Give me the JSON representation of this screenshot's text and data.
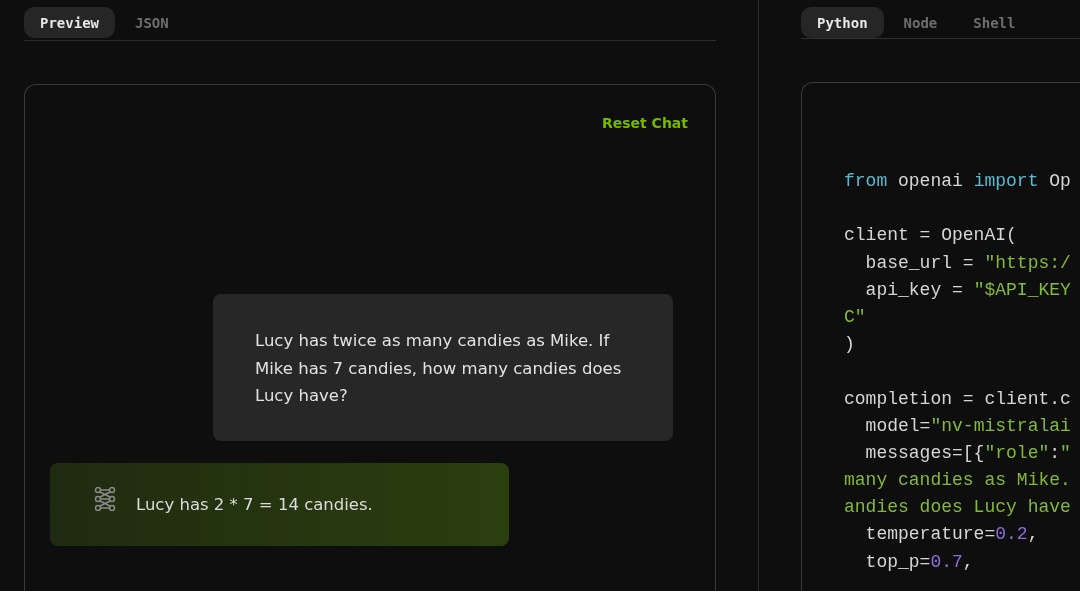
{
  "preview": {
    "tabs": [
      {
        "label": "Preview",
        "selected": true
      },
      {
        "label": "JSON",
        "selected": false
      }
    ],
    "reset_label": "Reset Chat",
    "messages": [
      {
        "kind": "user",
        "text": "Lucy has twice as many candies as Mike. If Mike has 7 candies, how many candies does Lucy have?"
      },
      {
        "kind": "assistant",
        "text": "Lucy has 2 * 7 = 14 candies."
      }
    ]
  },
  "code": {
    "tabs": [
      {
        "label": "Python",
        "selected": true
      },
      {
        "label": "Node",
        "selected": false
      },
      {
        "label": "Shell",
        "selected": false
      }
    ],
    "blocks": [
      [
        [
          {
            "kind": "keyword",
            "text": "from"
          },
          {
            "kind": "plain",
            "text": " openai "
          },
          {
            "kind": "keyword",
            "text": "import"
          },
          {
            "kind": "plain",
            "text": " Op"
          }
        ]
      ],
      [
        [
          {
            "kind": "plain",
            "text": "client = OpenAI("
          }
        ],
        [
          {
            "kind": "plain",
            "text": "  base_url = "
          },
          {
            "kind": "string",
            "text": "\"https:/"
          }
        ],
        [
          {
            "kind": "plain",
            "text": "  api_key = "
          },
          {
            "kind": "string",
            "text": "\"$API_KEY"
          }
        ],
        [
          {
            "kind": "string",
            "text": "C\""
          }
        ],
        [
          {
            "kind": "plain",
            "text": ")"
          }
        ]
      ],
      [
        [
          {
            "kind": "plain",
            "text": "completion = client.c"
          }
        ],
        [
          {
            "kind": "plain",
            "text": "  model="
          },
          {
            "kind": "string",
            "text": "\"nv-mistralai"
          }
        ],
        [
          {
            "kind": "plain",
            "text": "  messages=[{"
          },
          {
            "kind": "string",
            "text": "\"role\""
          },
          {
            "kind": "plain",
            "text": ":"
          },
          {
            "kind": "string",
            "text": "\""
          }
        ],
        [
          {
            "kind": "string",
            "text": "many candies as Mike."
          }
        ],
        [
          {
            "kind": "string",
            "text": "andies does Lucy have"
          }
        ],
        [
          {
            "kind": "plain",
            "text": "  temperature="
          },
          {
            "kind": "number",
            "text": "0.2"
          },
          {
            "kind": "plain",
            "text": ","
          }
        ],
        [
          {
            "kind": "plain",
            "text": "  top_p="
          },
          {
            "kind": "number",
            "text": "0.7"
          },
          {
            "kind": "plain",
            "text": ","
          }
        ]
      ]
    ]
  }
}
